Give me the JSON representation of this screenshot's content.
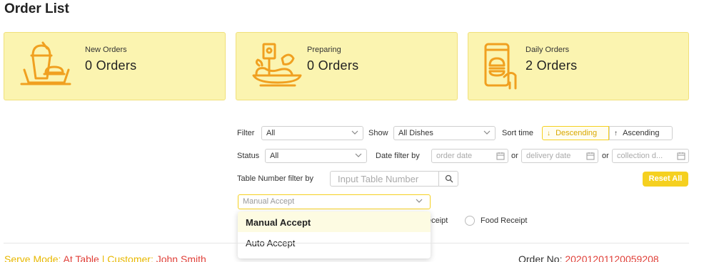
{
  "page": {
    "title": "Order List"
  },
  "cards": [
    {
      "label": "New Orders",
      "value": "0 Orders",
      "icon": "drink-tray-icon"
    },
    {
      "label": "Preparing",
      "value": "0 Orders",
      "icon": "cooking-dish-icon"
    },
    {
      "label": "Daily Orders",
      "value": "2 Orders",
      "icon": "mobile-order-icon"
    }
  ],
  "filters": {
    "filter_label": "Filter",
    "filter_value": "All",
    "show_label": "Show",
    "show_value": "All Dishes",
    "sort_label": "Sort time",
    "sort_desc": "Descending",
    "sort_asc": "Ascending",
    "status_label": "Status",
    "status_value": "All",
    "date_filter_label": "Date filter by",
    "order_date_placeholder": "order date",
    "or1": "or",
    "delivery_date_placeholder": "delivery date",
    "or2": "or",
    "collection_date_placeholder": "collection d...",
    "table_label": "Table Number filter by",
    "table_placeholder": "Input Table Number",
    "reset_label": "Reset All",
    "accept_value": "Manual Accept",
    "accept_options": [
      "Manual Accept",
      "Auto Accept"
    ],
    "receipt_partial": "eceipt",
    "food_receipt": "Food Receipt"
  },
  "order": {
    "serve_mode_label": "Serve Mode:",
    "serve_mode_value": "At Table",
    "separator": "|",
    "customer_label": "Customer:",
    "customer_value": "John Smith",
    "order_no_label": "Order No:",
    "order_no_value": "20201201120059208"
  },
  "colors": {
    "card_bg": "#fbf4b0",
    "accent_yellow": "#f5d020",
    "icon_orange": "#f0a020",
    "order_red": "#e0413a"
  }
}
